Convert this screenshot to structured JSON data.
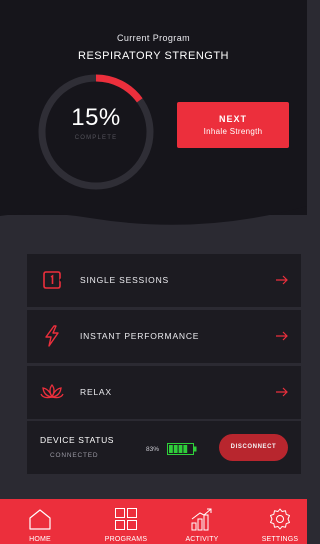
{
  "program": {
    "label": "Current Program",
    "name": "RESPIRATORY STRENGTH",
    "progress_percent_text": "15%",
    "progress_fraction": 0.15,
    "complete_label": "COMPLETE"
  },
  "next_button": {
    "line1": "NEXT",
    "line2": "Inhale Strength"
  },
  "sessions": [
    {
      "label": "SINGLE SESSIONS",
      "icon": "single-session-icon"
    },
    {
      "label": "INSTANT PERFORMANCE",
      "icon": "lightning-icon"
    },
    {
      "label": "RELAX",
      "icon": "lotus-icon"
    }
  ],
  "device": {
    "title": "DEVICE STATUS",
    "status": "CONNECTED",
    "battery_text": "83%",
    "battery_fraction": 0.83,
    "disconnect_label": "DISCONNECT"
  },
  "nav": [
    {
      "label": "HOME",
      "icon": "home-icon"
    },
    {
      "label": "PROGRAMS",
      "icon": "grid-icon"
    },
    {
      "label": "ACTIVITY",
      "icon": "chart-icon"
    },
    {
      "label": "SETTINGS",
      "icon": "gear-icon"
    }
  ],
  "colors": {
    "accent": "#ec2f3c",
    "background_top": "#16151b",
    "background": "#2b2a32",
    "panel": "#1c1b21",
    "battery": "#2fcf3a"
  }
}
